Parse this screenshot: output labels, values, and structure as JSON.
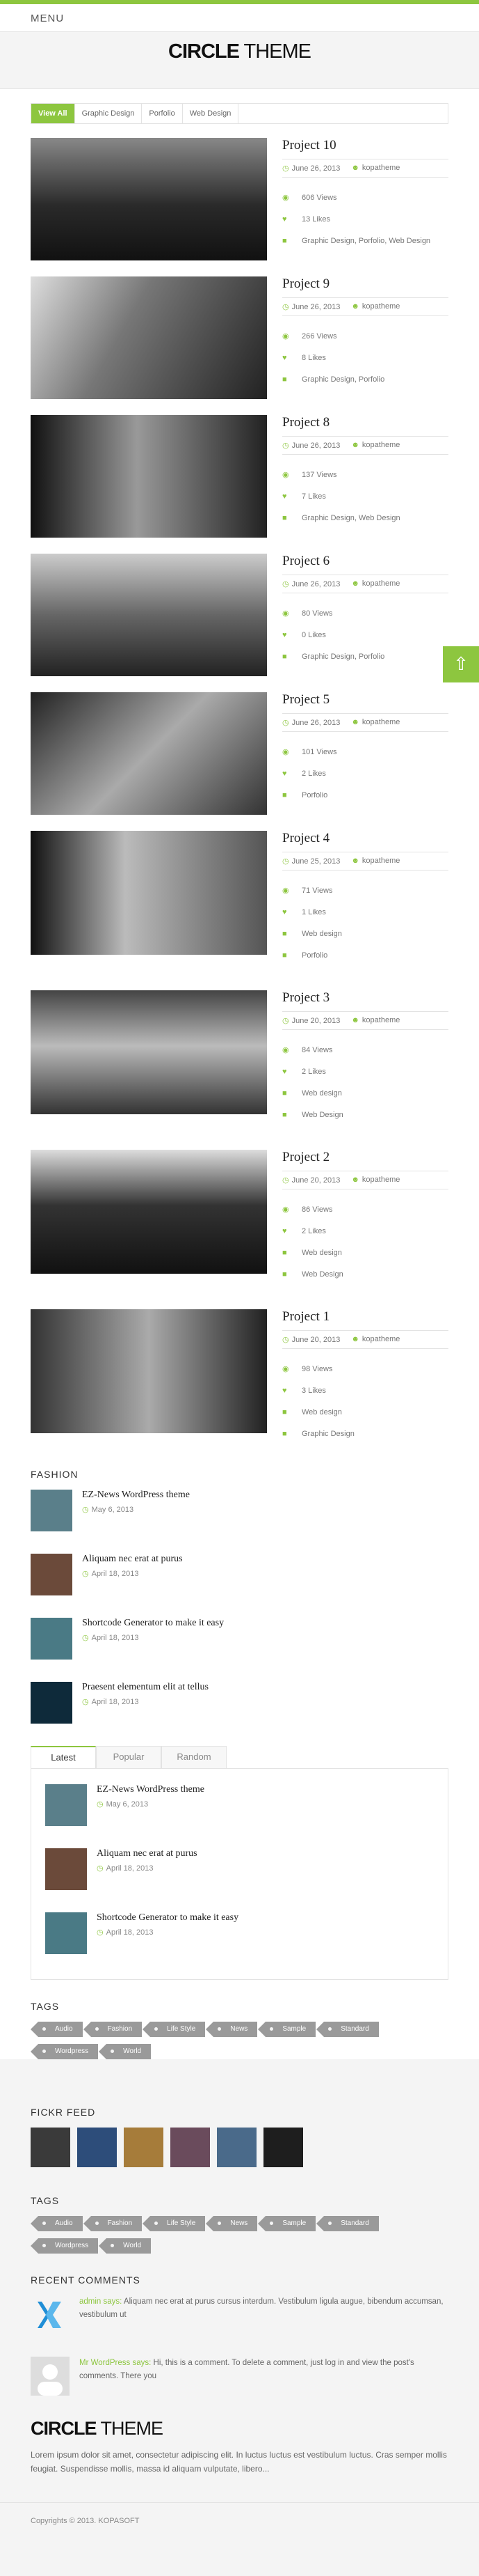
{
  "menu": {
    "label": "MENU"
  },
  "logo": {
    "bold": "CIRCLE",
    "light": " THEME"
  },
  "filters": [
    "View All",
    "Graphic Design",
    "Porfolio",
    "Web Design"
  ],
  "projects": [
    {
      "title": "Project 10",
      "date": "June 26, 2013",
      "author": "kopatheme",
      "views": "606 Views",
      "likes": "13 Likes",
      "cats": [
        "Graphic Design, Porfolio, Web Design"
      ]
    },
    {
      "title": "Project 9",
      "date": "June 26, 2013",
      "author": "kopatheme",
      "views": "266 Views",
      "likes": "8 Likes",
      "cats": [
        "Graphic Design, Porfolio"
      ]
    },
    {
      "title": "Project 8",
      "date": "June 26, 2013",
      "author": "kopatheme",
      "views": "137 Views",
      "likes": "7 Likes",
      "cats": [
        "Graphic Design, Web Design"
      ]
    },
    {
      "title": "Project 6",
      "date": "June 26, 2013",
      "author": "kopatheme",
      "views": "80 Views",
      "likes": "0 Likes",
      "cats": [
        "Graphic Design, Porfolio"
      ]
    },
    {
      "title": "Project 5",
      "date": "June 26, 2013",
      "author": "kopatheme",
      "views": "101 Views",
      "likes": "2 Likes",
      "cats": [
        "Porfolio"
      ]
    },
    {
      "title": "Project 4",
      "date": "June 25, 2013",
      "author": "kopatheme",
      "views": "71 Views",
      "likes": "1 Likes",
      "cats": [
        "Web design",
        "Porfolio"
      ]
    },
    {
      "title": "Project 3",
      "date": "June 20, 2013",
      "author": "kopatheme",
      "views": "84 Views",
      "likes": "2 Likes",
      "cats": [
        "Web design",
        "Web Design"
      ]
    },
    {
      "title": "Project 2",
      "date": "June 20, 2013",
      "author": "kopatheme",
      "views": "86 Views",
      "likes": "2 Likes",
      "cats": [
        "Web design",
        "Web Design"
      ]
    },
    {
      "title": "Project 1",
      "date": "June 20, 2013",
      "author": "kopatheme",
      "views": "98 Views",
      "likes": "3 Likes",
      "cats": [
        "Web design",
        "Graphic Design"
      ]
    }
  ],
  "fashion": {
    "title": "FASHION",
    "posts": [
      {
        "title": "EZ-News WordPress theme",
        "date": "May 6, 2013"
      },
      {
        "title": "Aliquam nec erat at purus",
        "date": "April 18, 2013"
      },
      {
        "title": "Shortcode Generator to make it easy",
        "date": "April 18, 2013"
      },
      {
        "title": "Praesent elementum elit at tellus",
        "date": "April 18, 2013"
      }
    ]
  },
  "tabs": {
    "labels": [
      "Latest",
      "Popular",
      "Random"
    ],
    "posts": [
      {
        "title": "EZ-News WordPress theme",
        "date": "May 6, 2013"
      },
      {
        "title": "Aliquam nec erat at purus",
        "date": "April 18, 2013"
      },
      {
        "title": "Shortcode Generator to make it easy",
        "date": "April 18, 2013"
      }
    ]
  },
  "tags": {
    "title": "TAGS",
    "items": [
      "Audio",
      "Fashion",
      "Life Style",
      "News",
      "Sample",
      "Standard",
      "Wordpress",
      "World"
    ]
  },
  "footer": {
    "flickr_title": "FICKR FEED",
    "tags_title": "TAGS",
    "comments_title": "RECENT COMMENTS",
    "comments": [
      {
        "who": "admin says:",
        "text": "Aliquam nec erat at purus cursus interdum. Vestibulum ligula augue, bibendum accumsan, vestibulum ut"
      },
      {
        "who": "Mr WordPress says:",
        "text": "Hi, this is a comment. To delete a comment, just log in and view the post's comments. There you"
      }
    ],
    "about": "Lorem ipsum dolor sit amet, consectetur adipiscing elit. In luctus luctus est vestibulum luctus. Cras semper mollis feugiat. Suspendisse mollis, massa id aliquam vulputate, libero...",
    "copyright": "Copyrights © 2013. KOPASOFT"
  },
  "colors": {
    "accent": "#8dc63f"
  }
}
